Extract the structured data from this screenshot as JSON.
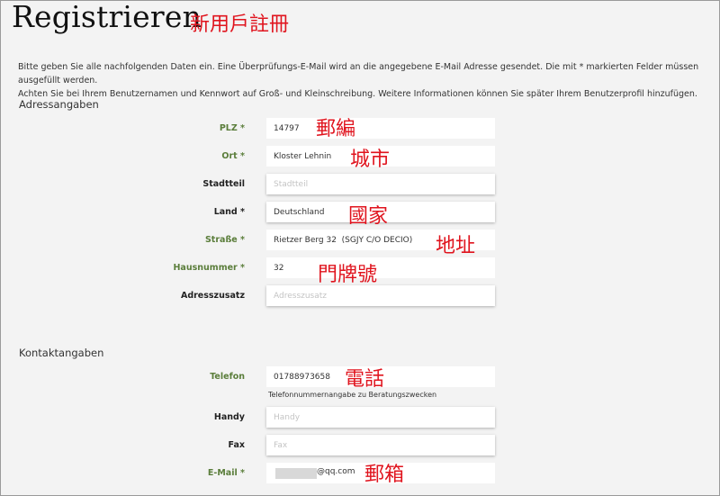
{
  "page": {
    "title": "Registrieren",
    "title_note": "新用戶註冊",
    "intro_line1": "Bitte geben Sie alle nachfolgenden Daten ein. Eine Überprüfungs-E-Mail wird an die angegebene E-Mail Adresse gesendet. Die mit * markierten Felder müssen ausgefüllt werden.",
    "intro_line2": "Achten Sie bei Ihrem Benutzernamen und Kennwort auf Groß- und Kleinschreibung. Weitere Informationen können Sie später Ihrem Benutzerprofil hinzufügen."
  },
  "address": {
    "heading": "Adressangaben",
    "plz": {
      "label": "PLZ *",
      "value": "14797",
      "note": "郵編"
    },
    "ort": {
      "label": "Ort *",
      "value": "Kloster Lehnin",
      "note": "城市"
    },
    "stadtteil": {
      "label": "Stadtteil",
      "placeholder": "Stadtteil"
    },
    "land": {
      "label": "Land *",
      "value": "Deutschland",
      "note": "國家"
    },
    "strasse": {
      "label": "Straße *",
      "value": "Rietzer Berg 32  (SGJY C/O DECIO)",
      "note": "地址"
    },
    "hausnummer": {
      "label": "Hausnummer *",
      "value": "32",
      "note": "門牌號"
    },
    "zusatz": {
      "label": "Adresszusatz",
      "placeholder": "Adresszusatz"
    }
  },
  "contact": {
    "heading": "Kontaktangaben",
    "telefon": {
      "label": "Telefon",
      "value": "01788973658",
      "note": "電話",
      "hint": "Telefonnummernangabe zu Beratungszwecken"
    },
    "handy": {
      "label": "Handy",
      "placeholder": "Handy"
    },
    "fax": {
      "label": "Fax",
      "placeholder": "Fax"
    },
    "email": {
      "label": "E-Mail *",
      "value_suffix": "@qq.com",
      "note": "郵箱"
    }
  }
}
